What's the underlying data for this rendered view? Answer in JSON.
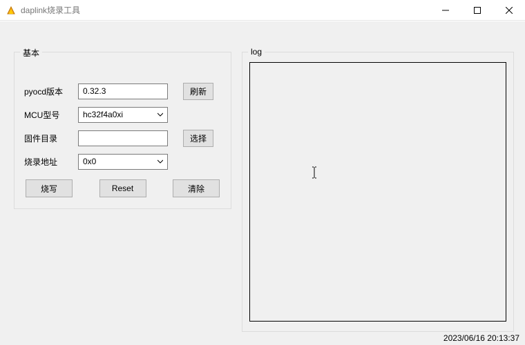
{
  "window": {
    "title": "daplink烧录工具"
  },
  "groups": {
    "basic_title": "基本",
    "log_title": "log"
  },
  "labels": {
    "pyocd_version": "pyocd版本",
    "mcu_model": "MCU型号",
    "firmware_dir": "固件目录",
    "burn_address": "烧录地址"
  },
  "values": {
    "pyocd_version": "0.32.3",
    "mcu_model": "hc32f4a0xi",
    "firmware_dir": "",
    "burn_address": "0x0"
  },
  "buttons": {
    "refresh": "刷新",
    "select": "选择",
    "burn": "烧写",
    "reset": "Reset",
    "clear": "清除"
  },
  "statusbar": {
    "datetime": "2023/06/16 20:13:37"
  }
}
